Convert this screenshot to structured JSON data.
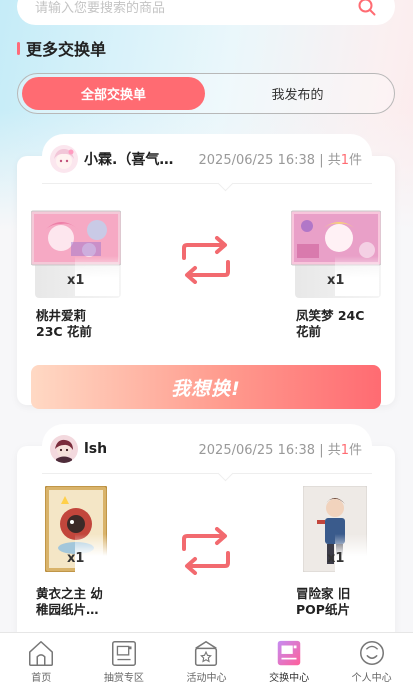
{
  "search": {
    "placeholder": "请输入您要搜索的商品"
  },
  "section": {
    "title": "更多交换单"
  },
  "tabs": [
    {
      "label": "全部交换单",
      "active": true
    },
    {
      "label": "我发布的",
      "active": false
    }
  ],
  "orders": [
    {
      "user": "小霖.（喜气…",
      "datetime": "2025/06/25 16:38",
      "total_prefix": "| 共",
      "total_count": "1",
      "total_suffix": "件",
      "give": {
        "name_line1": "桃井爱莉",
        "name_line2": "23C 花前",
        "qty": "x1"
      },
      "get": {
        "name_line1": "凤笑梦 24C",
        "name_line2": "花前",
        "qty": "x1"
      },
      "button": "我想换!"
    },
    {
      "user": "lsh",
      "datetime": "2025/06/25 16:38",
      "total_prefix": "| 共",
      "total_count": "1",
      "total_suffix": "件",
      "give": {
        "name_line1": "黄衣之主 幼",
        "name_line2": "稚园纸片…",
        "qty": "x1"
      },
      "get": {
        "name_line1": "冒险家 旧",
        "name_line2": "POP纸片",
        "qty": "x1"
      }
    }
  ],
  "nav": [
    {
      "label": "首页",
      "icon": "home-icon",
      "active": false
    },
    {
      "label": "抽赏专区",
      "icon": "gacha-icon",
      "active": false
    },
    {
      "label": "活动中心",
      "icon": "gift-icon",
      "active": false
    },
    {
      "label": "交换中心",
      "icon": "exchange-icon",
      "active": true
    },
    {
      "label": "个人中心",
      "icon": "profile-icon",
      "active": false
    }
  ],
  "colors": {
    "accent": "#ff6b72",
    "swap": "#f26a6f",
    "muted": "#999999"
  }
}
